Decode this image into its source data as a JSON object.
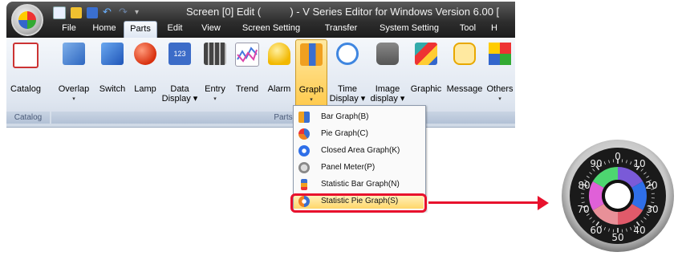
{
  "window": {
    "title": "Screen [0] Edit (          ) - V Series Editor for Windows Version 6.00 ["
  },
  "tabs": [
    "File",
    "Home",
    "Parts",
    "Edit",
    "View",
    "Screen Setting",
    "Transfer",
    "System Setting",
    "Tool",
    "H"
  ],
  "active_tab": "Parts",
  "ribbon": {
    "catalog_group_label": "Catalog",
    "parts_group_label": "Parts",
    "buttons": [
      {
        "label": "Catalog",
        "label2": "",
        "icon": "catalog-book-icon",
        "dropdown": false
      },
      {
        "label": "Overlap",
        "label2": "",
        "icon": "overlap-icon",
        "dropdown": true
      },
      {
        "label": "Switch",
        "label2": "",
        "icon": "switch-icon",
        "dropdown": false
      },
      {
        "label": "Lamp",
        "label2": "",
        "icon": "lamp-icon",
        "dropdown": false
      },
      {
        "label": "Data",
        "label2": "Display",
        "icon": "data-display-icon",
        "dropdown": true
      },
      {
        "label": "Entry",
        "label2": "",
        "icon": "entry-icon",
        "dropdown": true
      },
      {
        "label": "Trend",
        "label2": "",
        "icon": "trend-icon",
        "dropdown": false
      },
      {
        "label": "Alarm",
        "label2": "",
        "icon": "alarm-bell-icon",
        "dropdown": false
      },
      {
        "label": "Graph",
        "label2": "",
        "icon": "graph-icon",
        "dropdown": true
      },
      {
        "label": "Time",
        "label2": "Display",
        "icon": "clock-icon",
        "dropdown": true
      },
      {
        "label": "Image",
        "label2": "display",
        "icon": "camera-icon",
        "dropdown": true
      },
      {
        "label": "Graphic",
        "label2": "",
        "icon": "graphic-icon",
        "dropdown": false
      },
      {
        "label": "Message",
        "label2": "",
        "icon": "message-icon",
        "dropdown": false
      },
      {
        "label": "Others",
        "label2": "",
        "icon": "others-icon",
        "dropdown": true
      }
    ]
  },
  "graph_menu": {
    "items": [
      {
        "label": "Bar Graph(B)",
        "icon": "bar-graph-icon"
      },
      {
        "label": "Pie Graph(C)",
        "icon": "pie-graph-icon"
      },
      {
        "label": "Closed Area Graph(K)",
        "icon": "closed-area-graph-icon"
      },
      {
        "label": "Panel Meter(P)",
        "icon": "panel-meter-icon"
      },
      {
        "label": "Statistic Bar Graph(N)",
        "icon": "statistic-bar-graph-icon"
      },
      {
        "label": "Statistic Pie Graph(S)",
        "icon": "statistic-pie-graph-icon"
      }
    ],
    "highlighted": "Statistic Pie Graph(S)"
  },
  "gauge_preview": {
    "scale_labels": [
      "0",
      "10",
      "20",
      "30",
      "40",
      "50",
      "60",
      "70",
      "80",
      "90"
    ],
    "segment_colors": [
      "#7a5ad8",
      "#2f6fe8",
      "#e05a6a",
      "#e89098",
      "#e060d8",
      "#4dd670"
    ]
  },
  "colors": {
    "callout": "#e8112d",
    "menu_highlight": "#ffd76a"
  }
}
